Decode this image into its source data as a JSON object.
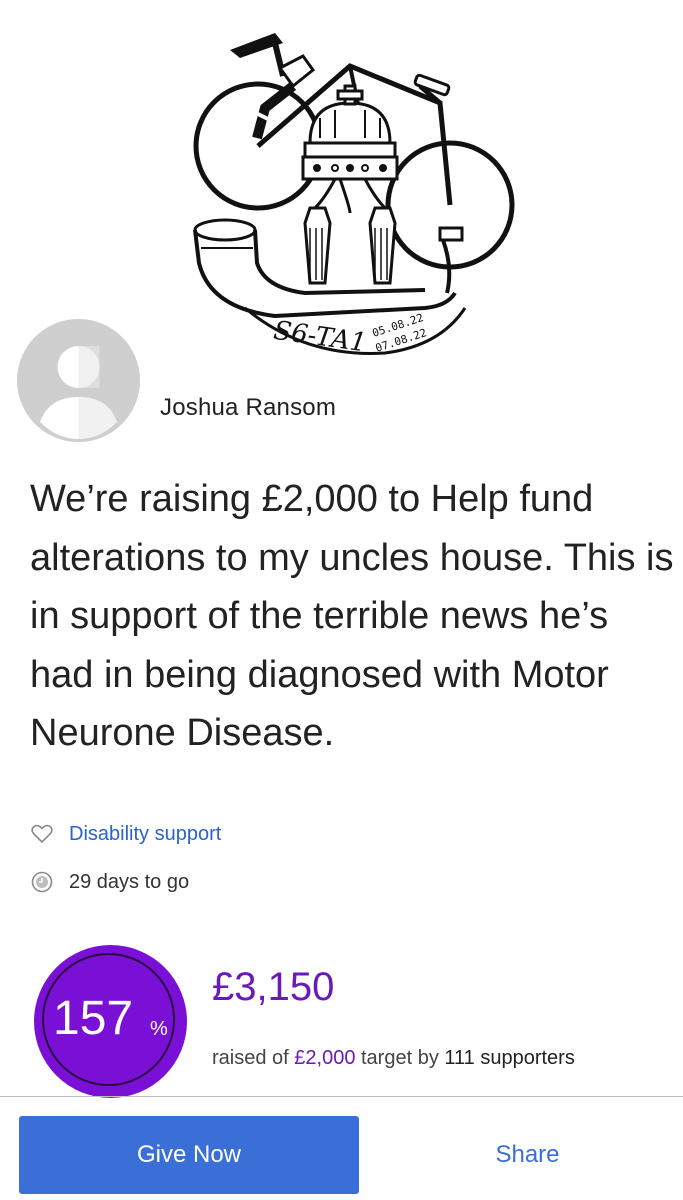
{
  "campaign": {
    "logo_alt": "S6-TA1 bicycle and crown badge",
    "logo_text": {
      "main": "S6-TA1",
      "date_start": "05.08.22",
      "date_end": "07.08.22"
    },
    "owner_name": "Joshua Ransom",
    "description": "We’re raising £2,000 to Help fund alterations to my uncles house. This is in support of the terrible news he’s had in being diagnosed with Motor Neurone Disease.",
    "category": {
      "icon": "heart-icon",
      "label": "Disability support"
    },
    "time_left": {
      "icon": "clock-icon",
      "label": "29 days to go"
    }
  },
  "progress": {
    "percent": "157",
    "unit": "%",
    "raised": "£3,150",
    "raised_prefix": "raised of ",
    "target": "£2,000",
    "target_suffix": " target by ",
    "supporters_count": "111",
    "supporters_label": " supporters"
  },
  "actions": {
    "give_label": "Give Now",
    "share_label": "Share"
  },
  "colors": {
    "accent_purple": "#7a10d6",
    "button_blue": "#3a6fd8",
    "link_blue": "#2a63c9"
  }
}
